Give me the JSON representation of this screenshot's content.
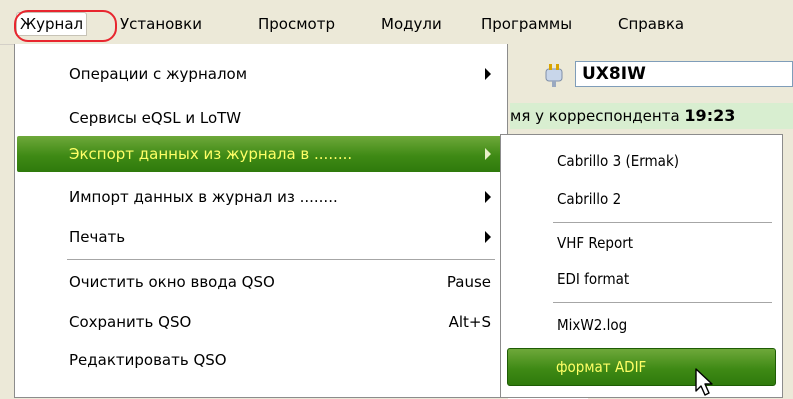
{
  "menubar": {
    "items": [
      "Журнал",
      "Установки",
      "Просмотр",
      "Модули",
      "Программы",
      "Справка"
    ],
    "open_index": 0
  },
  "background": {
    "callsign": "UX8IW",
    "corr_time_label": "мя у корреспондента",
    "corr_time_value": "19:23"
  },
  "menu": {
    "items": [
      {
        "label": "Операции с журналом",
        "submenu": true
      },
      {
        "label": "Сервисы eQSL и LoTW"
      },
      {
        "label": "Экспорт данных из журнала в ........",
        "submenu": true,
        "active": true
      },
      {
        "label": "Импорт данных в журнал из ........",
        "submenu": true
      },
      {
        "label": "Печать",
        "submenu": true
      },
      {
        "label": "Очистить окно ввода QSO",
        "shortcut": "Pause"
      },
      {
        "label": "Сохранить QSO",
        "shortcut": "Alt+S"
      },
      {
        "label": "Редактировать QSO"
      }
    ]
  },
  "submenu": {
    "items": [
      "Cabrillo 3 (Ermak)",
      "Cabrillo 2",
      "VHF Report",
      "EDI format",
      "MixW2.log",
      "формат ADIF"
    ],
    "active_index": 5
  },
  "colors": {
    "highlight_green_top": "#6ea83a",
    "highlight_green_bottom": "#2f7a0c",
    "highlight_text": "#ffff66",
    "annotation_ring": "#e8262f"
  }
}
